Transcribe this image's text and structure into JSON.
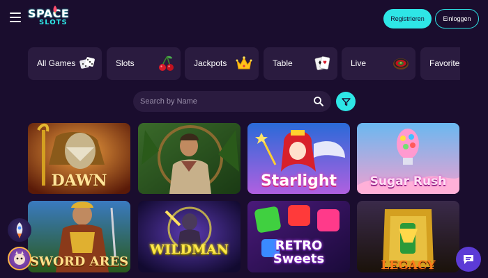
{
  "header": {
    "logo_line1": "SPACE",
    "logo_line2": "SLOTS",
    "register_label": "Registrieren",
    "login_label": "Einloggen"
  },
  "categories": [
    {
      "label": "All Games",
      "icon": "dice-icon"
    },
    {
      "label": "Slots",
      "icon": "cherries-icon"
    },
    {
      "label": "Jackpots",
      "icon": "crown-icon"
    },
    {
      "label": "Table",
      "icon": "cards-icon"
    },
    {
      "label": "Live",
      "icon": "roulette-icon"
    },
    {
      "label": "Favorite",
      "icon": "heart-icon"
    }
  ],
  "search": {
    "placeholder": "Search by Name"
  },
  "games": [
    {
      "title": "DAWN"
    },
    {
      "title": ""
    },
    {
      "title": "Starlight"
    },
    {
      "title": "Sugar Rush"
    },
    {
      "title": "SWORD ARES"
    },
    {
      "title": "WILDMAN"
    },
    {
      "title": "RETRO Sweets"
    },
    {
      "title": "LEGACY"
    }
  ],
  "colors": {
    "background": "#1a0d2e",
    "accent": "#2ee6e6",
    "card": "#2a1b3f",
    "chat": "#5c3bd6"
  }
}
